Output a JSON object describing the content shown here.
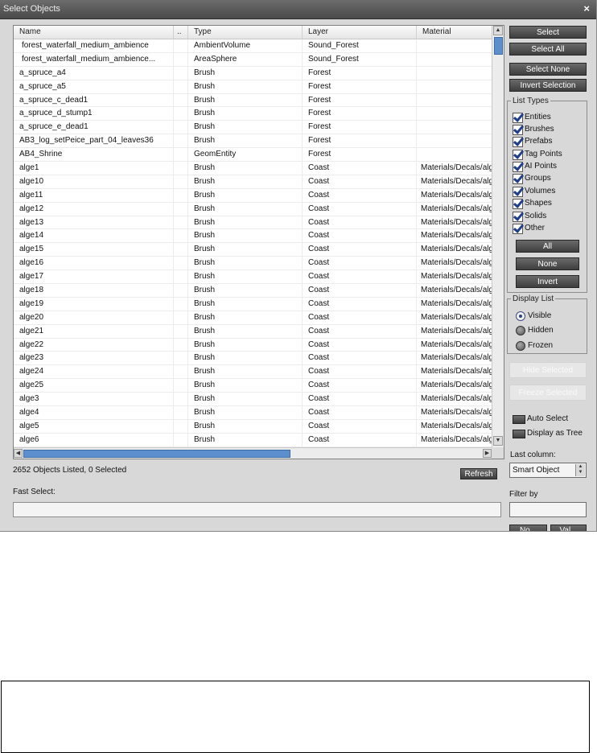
{
  "dialog": {
    "title": "Select Objects",
    "close_glyph": "×"
  },
  "columns": [
    "Name",
    "..",
    "Type",
    "Layer",
    "Material"
  ],
  "rows": [
    {
      "name": "forest_waterfall_medium_ambience",
      "type": "AmbientVolume",
      "layer": "Sound_Forest",
      "material": ""
    },
    {
      "name": "forest_waterfall_medium_ambience...",
      "type": "AreaSphere",
      "layer": "Sound_Forest",
      "material": ""
    },
    {
      "name": "a_spruce_a4",
      "type": "Brush",
      "layer": "Forest",
      "material": ""
    },
    {
      "name": "a_spruce_a5",
      "type": "Brush",
      "layer": "Forest",
      "material": ""
    },
    {
      "name": "a_spruce_c_dead1",
      "type": "Brush",
      "layer": "Forest",
      "material": ""
    },
    {
      "name": "a_spruce_d_stump1",
      "type": "Brush",
      "layer": "Forest",
      "material": ""
    },
    {
      "name": "a_spruce_e_dead1",
      "type": "Brush",
      "layer": "Forest",
      "material": ""
    },
    {
      "name": "AB3_log_setPeice_part_04_leaves36",
      "type": "Brush",
      "layer": "Forest",
      "material": ""
    },
    {
      "name": "AB4_Shrine",
      "type": "GeomEntity",
      "layer": "Forest",
      "material": ""
    },
    {
      "name": "alge1",
      "type": "Brush",
      "layer": "Coast",
      "material": "Materials/Decals/alg..."
    },
    {
      "name": "alge10",
      "type": "Brush",
      "layer": "Coast",
      "material": "Materials/Decals/alg..."
    },
    {
      "name": "alge11",
      "type": "Brush",
      "layer": "Coast",
      "material": "Materials/Decals/alg..."
    },
    {
      "name": "alge12",
      "type": "Brush",
      "layer": "Coast",
      "material": "Materials/Decals/alg..."
    },
    {
      "name": "alge13",
      "type": "Brush",
      "layer": "Coast",
      "material": "Materials/Decals/alg..."
    },
    {
      "name": "alge14",
      "type": "Brush",
      "layer": "Coast",
      "material": "Materials/Decals/alg..."
    },
    {
      "name": "alge15",
      "type": "Brush",
      "layer": "Coast",
      "material": "Materials/Decals/alg..."
    },
    {
      "name": "alge16",
      "type": "Brush",
      "layer": "Coast",
      "material": "Materials/Decals/alg..."
    },
    {
      "name": "alge17",
      "type": "Brush",
      "layer": "Coast",
      "material": "Materials/Decals/alg..."
    },
    {
      "name": "alge18",
      "type": "Brush",
      "layer": "Coast",
      "material": "Materials/Decals/alg..."
    },
    {
      "name": "alge19",
      "type": "Brush",
      "layer": "Coast",
      "material": "Materials/Decals/alg..."
    },
    {
      "name": "alge20",
      "type": "Brush",
      "layer": "Coast",
      "material": "Materials/Decals/alg..."
    },
    {
      "name": "alge21",
      "type": "Brush",
      "layer": "Coast",
      "material": "Materials/Decals/alg..."
    },
    {
      "name": "alge22",
      "type": "Brush",
      "layer": "Coast",
      "material": "Materials/Decals/alg..."
    },
    {
      "name": "alge23",
      "type": "Brush",
      "layer": "Coast",
      "material": "Materials/Decals/alg..."
    },
    {
      "name": "alge24",
      "type": "Brush",
      "layer": "Coast",
      "material": "Materials/Decals/alg..."
    },
    {
      "name": "alge25",
      "type": "Brush",
      "layer": "Coast",
      "material": "Materials/Decals/alg..."
    },
    {
      "name": "alge3",
      "type": "Brush",
      "layer": "Coast",
      "material": "Materials/Decals/alg..."
    },
    {
      "name": "alge4",
      "type": "Brush",
      "layer": "Coast",
      "material": "Materials/Decals/alg..."
    },
    {
      "name": "alge5",
      "type": "Brush",
      "layer": "Coast",
      "material": "Materials/Decals/alg..."
    },
    {
      "name": "alge6",
      "type": "Brush",
      "layer": "Coast",
      "material": "Materials/Decals/alg..."
    }
  ],
  "buttons": {
    "select": "Select",
    "select_all": "Select All",
    "select_none": "Select None",
    "invert_selection": "Invert Selection",
    "all": "All",
    "none": "None",
    "invert": "Invert",
    "hide_selected": "Hide Selected",
    "freeze_selected": "Freeze Selected",
    "refresh": "Refresh",
    "partial_1": "No...",
    "partial_2": "Val..."
  },
  "list_types": {
    "legend": "List Types",
    "items": [
      "Entities",
      "Brushes",
      "Prefabs",
      "Tag Points",
      "AI Points",
      "Groups",
      "Volumes",
      "Shapes",
      "Solids",
      "Other"
    ]
  },
  "display_list": {
    "legend": "Display List",
    "options": [
      "Visible",
      "Hidden",
      "Frozen"
    ],
    "selected": "Visible"
  },
  "toggles": {
    "auto_select": "Auto Select",
    "display_as_tree": "Display as Tree"
  },
  "last_column": {
    "label": "Last column:",
    "value": "Smart Object"
  },
  "filter": {
    "label": "Filter by",
    "value": ""
  },
  "status": "2652 Objects Listed,  0 Selected",
  "fast_select": {
    "label": "Fast Select:",
    "value": ""
  },
  "colors": {
    "dialog_bg": "#d8d8d8",
    "button_dark": "#4a4a4a",
    "scroll_thumb": "#5d8fcf",
    "check_mark": "#1f3f8a"
  }
}
